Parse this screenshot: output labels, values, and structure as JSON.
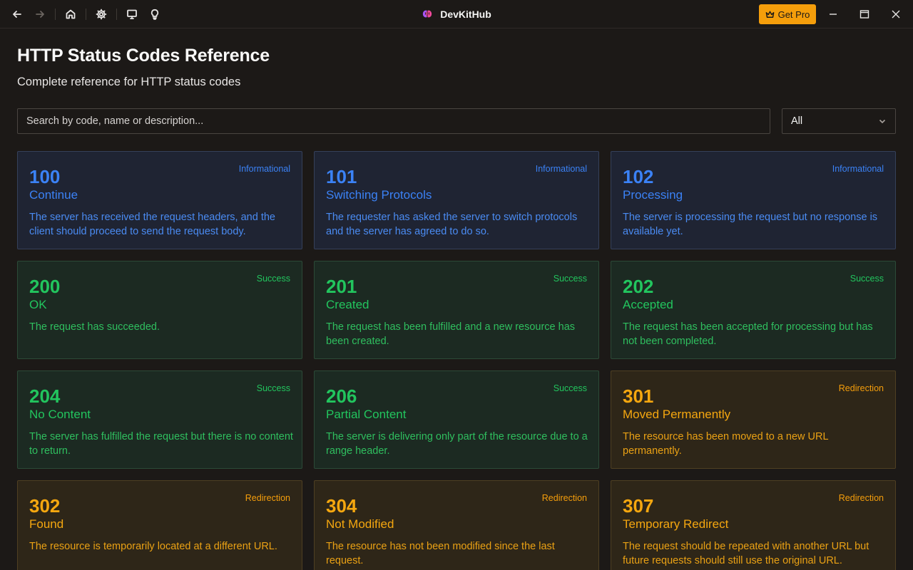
{
  "titlebar": {
    "app_name": "DevKitHub",
    "get_pro_label": "Get Pro",
    "icons": [
      "back-arrow-icon",
      "forward-arrow-icon",
      "home-icon",
      "gear-icon",
      "monitor-icon",
      "lightbulb-icon",
      "brain-logo-icon",
      "crown-icon",
      "minimize-icon",
      "maximize-icon",
      "close-icon"
    ]
  },
  "page": {
    "title": "HTTP Status Codes Reference",
    "subtitle": "Complete reference for HTTP status codes"
  },
  "search": {
    "placeholder": "Search by code, name or description...",
    "value": ""
  },
  "filter": {
    "selected": "All"
  },
  "colors": {
    "informational": "#3b82f6",
    "success": "#22c55e",
    "redirection": "#f59e0b",
    "accent_button": "#f59e0b",
    "background": "#1c1917"
  },
  "codes": [
    {
      "code": "100",
      "name": "Continue",
      "category": "Informational",
      "description": "The server has received the request headers, and the client should proceed to send the request body."
    },
    {
      "code": "101",
      "name": "Switching Protocols",
      "category": "Informational",
      "description": "The requester has asked the server to switch protocols and the server has agreed to do so."
    },
    {
      "code": "102",
      "name": "Processing",
      "category": "Informational",
      "description": "The server is processing the request but no response is available yet."
    },
    {
      "code": "200",
      "name": "OK",
      "category": "Success",
      "description": "The request has succeeded."
    },
    {
      "code": "201",
      "name": "Created",
      "category": "Success",
      "description": "The request has been fulfilled and a new resource has been created."
    },
    {
      "code": "202",
      "name": "Accepted",
      "category": "Success",
      "description": "The request has been accepted for processing but has not been completed."
    },
    {
      "code": "204",
      "name": "No Content",
      "category": "Success",
      "description": "The server has fulfilled the request but there is no content to return."
    },
    {
      "code": "206",
      "name": "Partial Content",
      "category": "Success",
      "description": "The server is delivering only part of the resource due to a range header."
    },
    {
      "code": "301",
      "name": "Moved Permanently",
      "category": "Redirection",
      "description": "The resource has been moved to a new URL permanently."
    },
    {
      "code": "302",
      "name": "Found",
      "category": "Redirection",
      "description": "The resource is temporarily located at a different URL."
    },
    {
      "code": "304",
      "name": "Not Modified",
      "category": "Redirection",
      "description": "The resource has not been modified since the last request."
    },
    {
      "code": "307",
      "name": "Temporary Redirect",
      "category": "Redirection",
      "description": "The request should be repeated with another URL but future requests should still use the original URL."
    }
  ]
}
